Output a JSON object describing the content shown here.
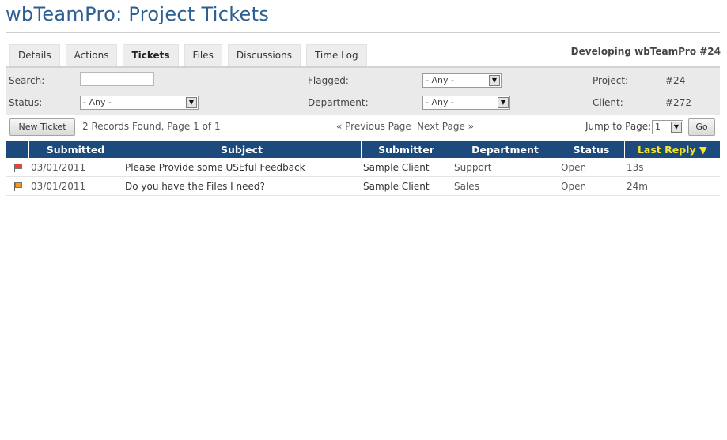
{
  "page": {
    "title": "wbTeamPro: Project Tickets"
  },
  "tabs": [
    {
      "label": "Details"
    },
    {
      "label": "Actions"
    },
    {
      "label": "Tickets",
      "active": true
    },
    {
      "label": "Files"
    },
    {
      "label": "Discussions"
    },
    {
      "label": "Time Log"
    }
  ],
  "project_heading": "Developing wbTeamPro #24",
  "filters": {
    "search_label": "Search:",
    "search_value": "",
    "status_label": "Status:",
    "status_value": "- Any -",
    "flagged_label": "Flagged:",
    "flagged_value": "- Any -",
    "department_label": "Department:",
    "department_value": "- Any -",
    "project_label": "Project:",
    "project_value": "#24",
    "client_label": "Client:",
    "client_value": "#272"
  },
  "toolbar": {
    "new_ticket_label": "New Ticket",
    "records_text": "2 Records Found, Page 1 of 1",
    "previous_label": "« Previous Page",
    "next_label": "Next Page »",
    "jump_label": "Jump to Page:",
    "jump_value": "1",
    "go_label": "Go"
  },
  "table": {
    "columns": [
      "Submitted",
      "Subject",
      "Submitter",
      "Department",
      "Status",
      "Last Reply ▼"
    ],
    "sorted_column": 5,
    "rows": [
      {
        "flag_color": "#e8423a",
        "flag_icon": "red-flag-icon",
        "submitted": "03/01/2011",
        "subject": "Please Provide some USEful Feedback",
        "submitter": "Sample Client",
        "department": "Support",
        "status": "Open",
        "last_reply": "13s"
      },
      {
        "flag_color": "#f39a1e",
        "flag_icon": "orange-flag-icon",
        "submitted": "03/01/2011",
        "subject": "Do you have the Files I need?",
        "submitter": "Sample Client",
        "department": "Sales",
        "status": "Open",
        "last_reply": "24m"
      }
    ]
  },
  "colors": {
    "title": "#2d5f91",
    "header_bg": "#1c4a7c",
    "sorted_header": "#f5e52b"
  }
}
